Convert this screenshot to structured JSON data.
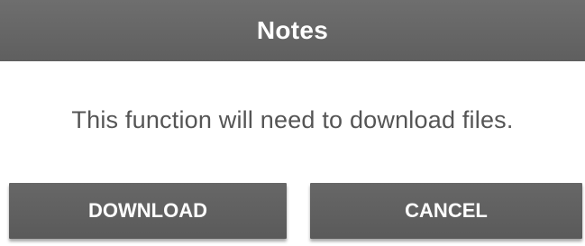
{
  "dialog": {
    "title": "Notes",
    "message": "This function will need to download files.",
    "buttons": {
      "download_label": "DOWNLOAD",
      "cancel_label": "CANCEL"
    }
  },
  "colors": {
    "title_bar": "#656565",
    "button": "#606060",
    "message_text": "#555555",
    "background": "#ffffff"
  }
}
